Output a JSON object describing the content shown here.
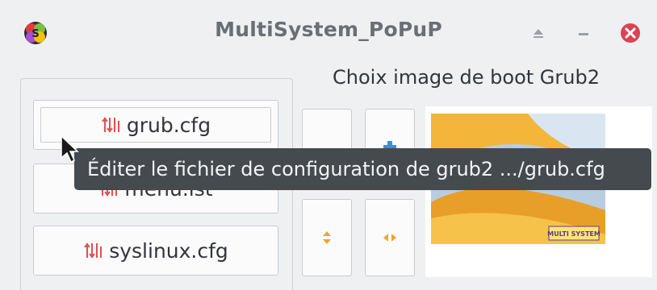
{
  "window": {
    "title": "MultiSystem_PoPuP",
    "app_icon": "multisystem-logo-icon",
    "controls": [
      "keep-above-icon",
      "minimize-icon",
      "close-icon"
    ],
    "close_color": "#da4453"
  },
  "left_buttons": [
    {
      "label": "grub.cfg",
      "icon": "config-sliders-icon"
    },
    {
      "label": "menu.lst",
      "icon": "config-sliders-icon"
    },
    {
      "label": "syslinux.cfg",
      "icon": "config-sliders-icon"
    }
  ],
  "grub_panel": {
    "heading": "Choix image de boot Grub2",
    "buttons": [
      "blank-icon",
      "add-icon",
      "vertical-resize-icon",
      "horizontal-resize-icon"
    ],
    "thumbnail_badge": "MULTI SYSTEM"
  },
  "tooltip": {
    "text": "Éditer le fichier de configuration de grub2 .../grub.cfg"
  },
  "colors": {
    "accent_orange": "#f5a623",
    "accent_blue": "#3b8ed8",
    "icon_red": "#e05050"
  }
}
